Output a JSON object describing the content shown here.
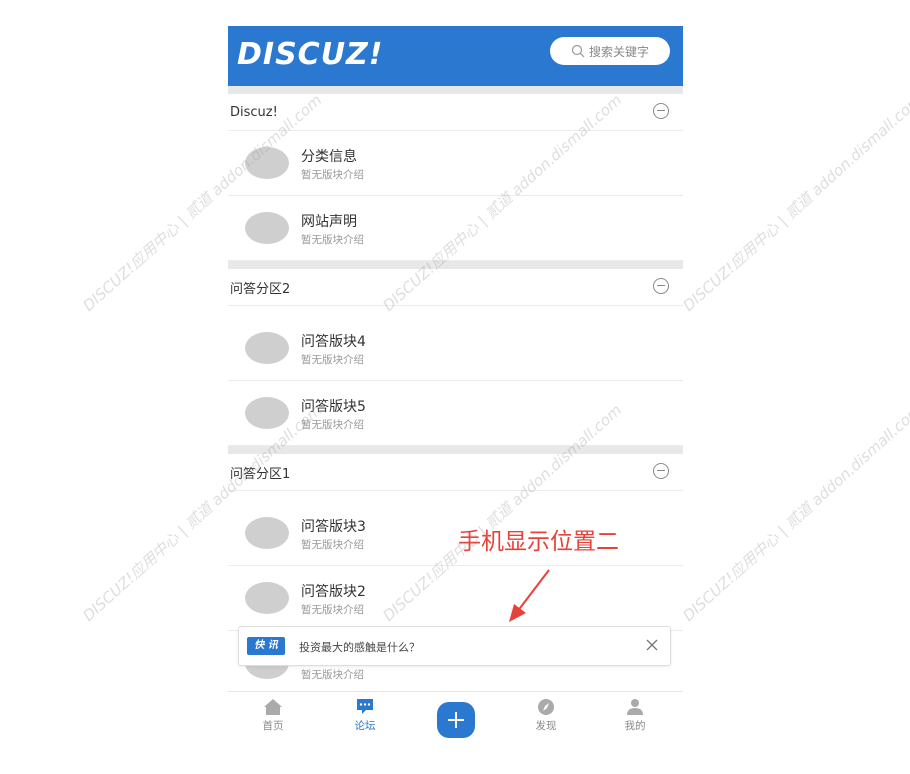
{
  "header": {
    "logo": "DISCUZ!",
    "search_placeholder": "搜索关键字"
  },
  "sections": [
    {
      "title": "Discuz!",
      "forums": [
        {
          "name": "分类信息",
          "desc": "暂无版块介绍"
        },
        {
          "name": "网站声明",
          "desc": "暂无版块介绍"
        }
      ]
    },
    {
      "title": "问答分区2",
      "forums": [
        {
          "name": "问答版块4",
          "desc": "暂无版块介绍"
        },
        {
          "name": "问答版块5",
          "desc": "暂无版块介绍"
        }
      ]
    },
    {
      "title": "问答分区1",
      "forums": [
        {
          "name": "问答版块3",
          "desc": "暂无版块介绍"
        },
        {
          "name": "问答版块2",
          "desc": "暂无版块介绍"
        },
        {
          "name": "",
          "desc": "暂无版块介绍"
        }
      ]
    }
  ],
  "news_bar": {
    "badge": "快 讯",
    "text": "投资最大的感触是什么？"
  },
  "tabbar": {
    "home": "首页",
    "forum": "论坛",
    "discover": "发现",
    "mine": "我的"
  },
  "annotation": "手机显示位置二",
  "watermark": "DISCUZ!应用中心 | 贰道 addon.dismall.com",
  "colors": {
    "brand": "#2a78cf",
    "annotation": "#e8413a"
  }
}
